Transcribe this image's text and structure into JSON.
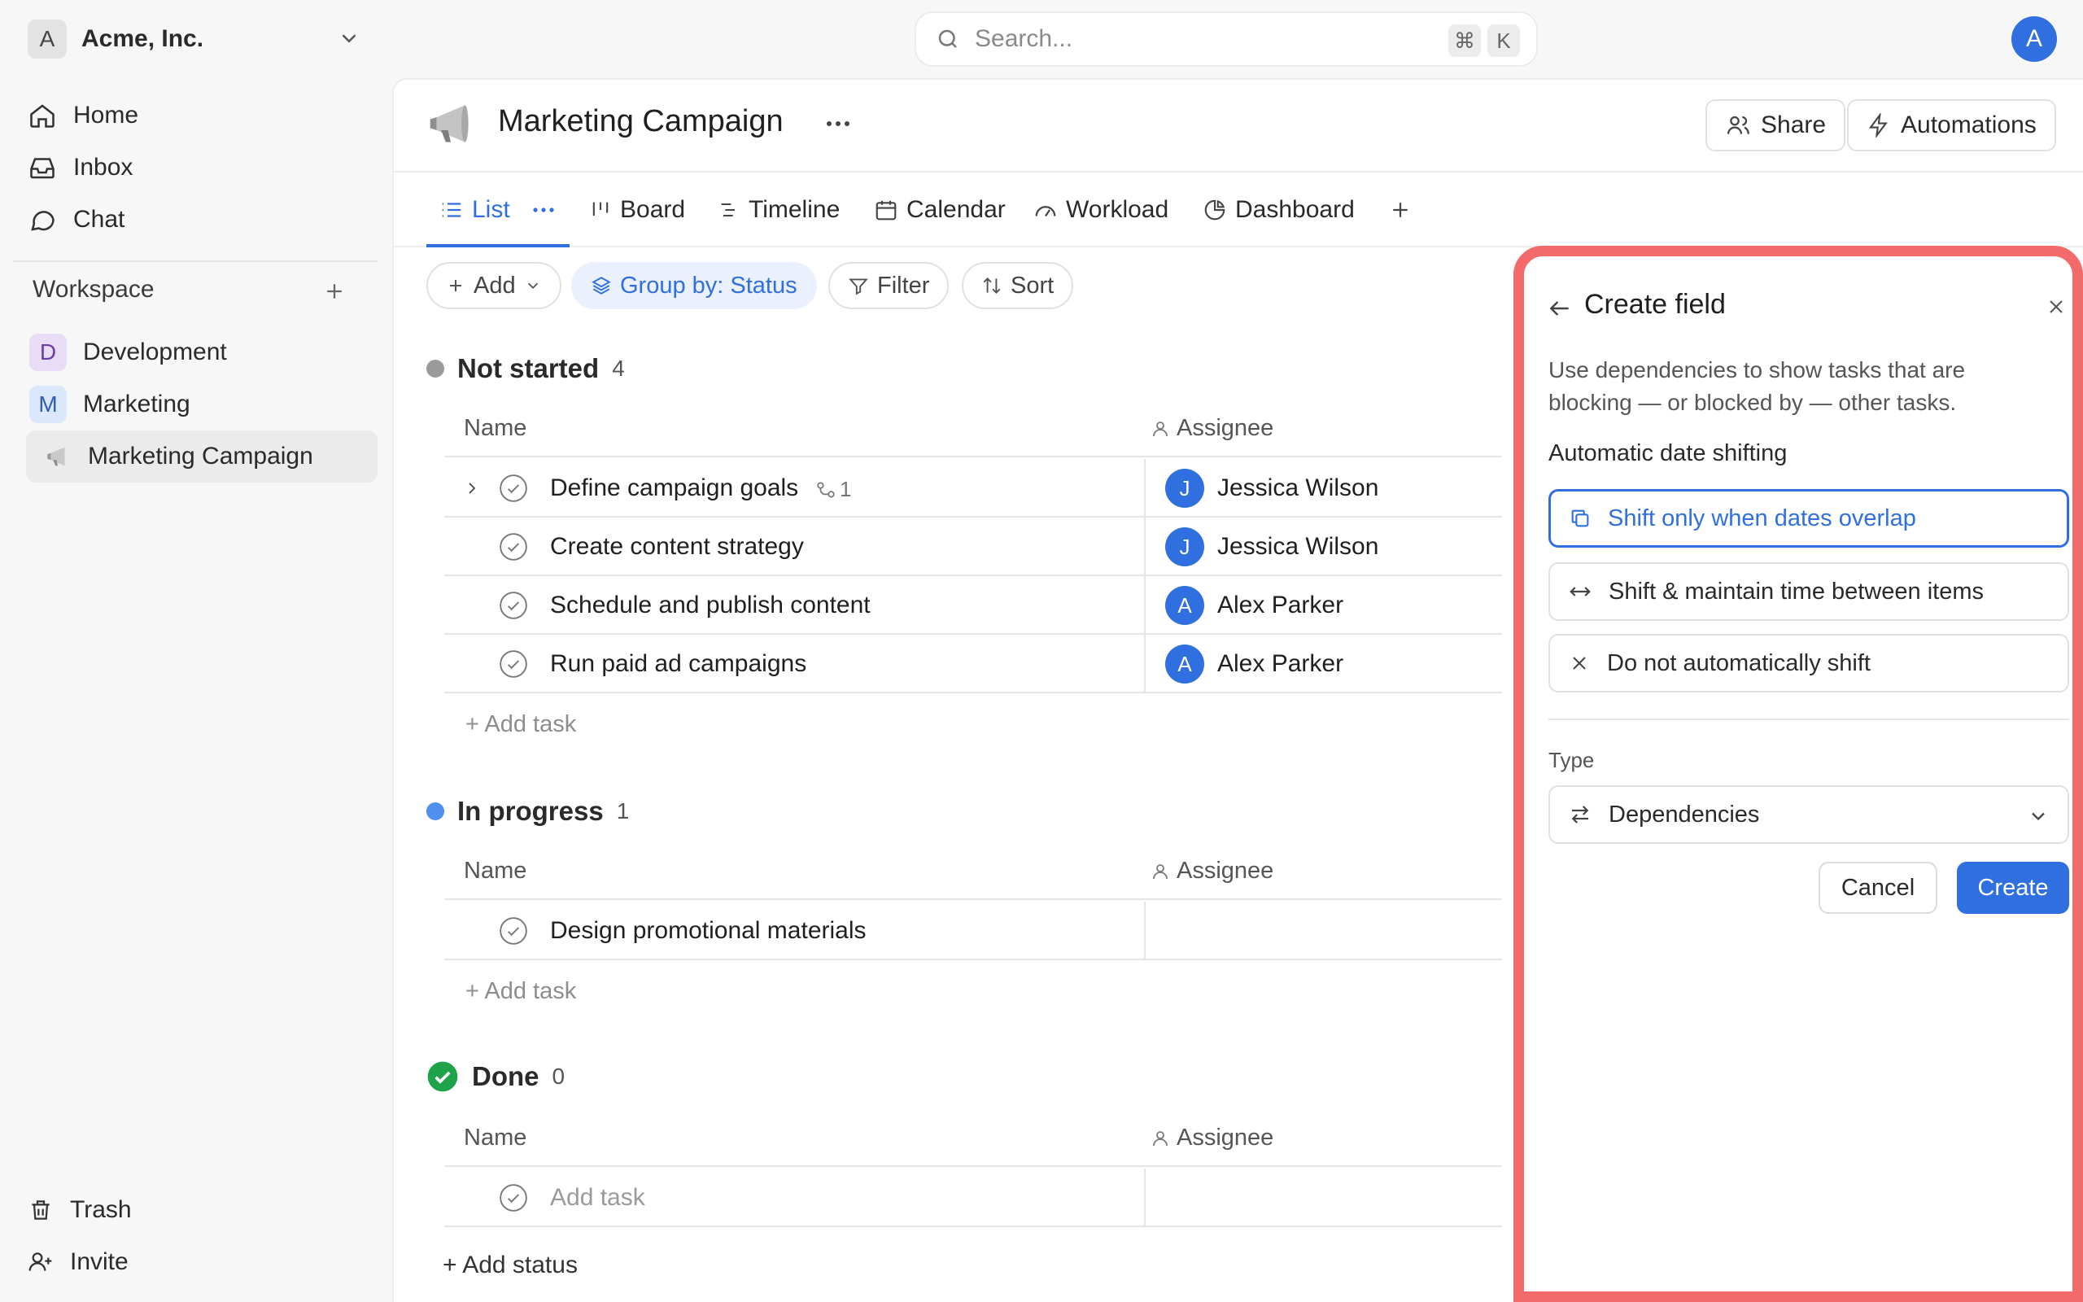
{
  "topbar": {
    "org_badge": "A",
    "org_name": "Acme, Inc.",
    "search_placeholder": "Search...",
    "shortcut_cmd": "⌘",
    "shortcut_key": "K",
    "user_avatar": "A"
  },
  "sidebar": {
    "nav": [
      {
        "label": "Home",
        "icon": "home-icon"
      },
      {
        "label": "Inbox",
        "icon": "inbox-icon"
      },
      {
        "label": "Chat",
        "icon": "chat-icon"
      }
    ],
    "workspace_title": "Workspace",
    "spaces": [
      {
        "badge": "D",
        "label": "Development",
        "color": "#e9dcf7"
      },
      {
        "badge": "M",
        "label": "Marketing",
        "color": "#dbe7fb"
      }
    ],
    "active_project": "Marketing Campaign",
    "footer": [
      {
        "label": "Trash",
        "icon": "trash-icon"
      },
      {
        "label": "Invite",
        "icon": "invite-icon"
      }
    ]
  },
  "project": {
    "title": "Marketing Campaign",
    "share_label": "Share",
    "automations_label": "Automations"
  },
  "tabs": [
    {
      "label": "List",
      "active": true
    },
    {
      "label": "Board"
    },
    {
      "label": "Timeline"
    },
    {
      "label": "Calendar"
    },
    {
      "label": "Workload"
    },
    {
      "label": "Dashboard"
    }
  ],
  "toolbar": {
    "add_label": "Add",
    "group_label": "Group by: Status",
    "filter_label": "Filter",
    "sort_label": "Sort"
  },
  "columns": {
    "name": "Name",
    "assignee": "Assignee"
  },
  "groups": [
    {
      "title": "Not started",
      "count": "4",
      "color": "#9b9b9b",
      "tasks": [
        {
          "name": "Define campaign goals",
          "subtasks": "1",
          "assignee": "Jessica Wilson",
          "initial": "J"
        },
        {
          "name": "Create content strategy",
          "assignee": "Jessica Wilson",
          "initial": "J"
        },
        {
          "name": "Schedule and publish content",
          "assignee": "Alex Parker",
          "initial": "A"
        },
        {
          "name": "Run paid ad campaigns",
          "assignee": "Alex Parker",
          "initial": "A"
        }
      ],
      "add_task": "+ Add task"
    },
    {
      "title": "In progress",
      "count": "1",
      "color": "#4f8ff0",
      "tasks": [
        {
          "name": "Design promotional materials"
        }
      ],
      "add_task": "+ Add task"
    },
    {
      "title": "Done",
      "count": "0",
      "color": "#1fa34a",
      "placeholder_task": "Add task"
    }
  ],
  "add_status": "+ Add status",
  "panel": {
    "title": "Create field",
    "description": "Use dependencies to show tasks that are blocking — or blocked by — other tasks.",
    "section_label": "Automatic date shifting",
    "options": [
      {
        "label": "Shift only when dates overlap",
        "selected": true
      },
      {
        "label": "Shift & maintain time between items"
      },
      {
        "label": "Do not automatically shift"
      }
    ],
    "type_label": "Type",
    "type_value": "Dependencies",
    "cancel_label": "Cancel",
    "create_label": "Create",
    "accent_color": "#2f6fe0",
    "highlight_color": "#f26a6a"
  }
}
